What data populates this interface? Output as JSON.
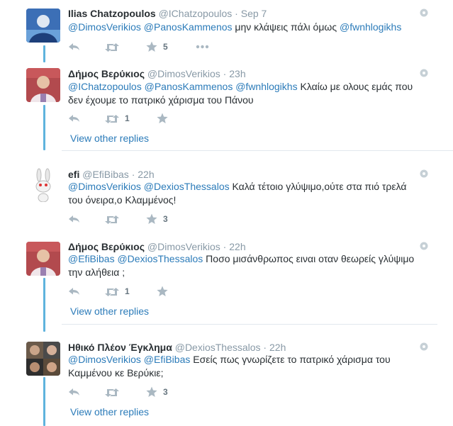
{
  "tweets": [
    {
      "fullname": "Ilias Chatzopoulos",
      "username": "@IChatzopoulos",
      "time": "Sep 7",
      "mentions": [
        "@DimosVerikios",
        "@PanosKammenos"
      ],
      "text_line1_mid": "μην κλάψεις πάλι όμως",
      "mention_end": "@fwnhlogikhs",
      "favorites": "5"
    },
    {
      "fullname": "Δήμος Βερύκιος",
      "username": "@DimosVerikios",
      "time": "23h",
      "mentions": [
        "@IChatzopoulos",
        "@PanosKammenos",
        "@fwnhlogikhs"
      ],
      "text_line1_end": "Κλαίω με ολους εμάς που",
      "text_line2": "δεν έχουμε το πατρικό χάρισμα του Πάνου",
      "retweets": "1",
      "view_other_replies": "View other replies"
    },
    {
      "fullname": "efi",
      "username": "@EfiBibas",
      "time": "22h",
      "mentions": [
        "@DimosVerikios",
        "@DexiosThessalos"
      ],
      "text_line1_end": "Καλά τέτοιο γλύψιμο,ούτε στα πιό τρελά",
      "text_line2": "του όνειρα,ο Κλαμμένος!",
      "favorites": "3"
    },
    {
      "fullname": "Δήμος Βερύκιος",
      "username": "@DimosVerikios",
      "time": "22h",
      "mentions": [
        "@EfiBibas",
        "@DexiosThessalos"
      ],
      "text_line1_end": "Ποσο μισάνθρωπος ειναι οταν θεωρείς γλύψιμο",
      "text_line2": "την αλήθεια ;",
      "retweets": "1",
      "view_other_replies": "View other replies"
    },
    {
      "fullname": "Ηθικό Πλέον Έγκλημα",
      "username": "@DexiosThessalos",
      "time": "22h",
      "mentions": [
        "@DimosVerikios",
        "@EfiBibas"
      ],
      "text_line1_end": "Εσείς πως γνωρίζετε το πατρικό χάρισμα του",
      "text_line2": "Καμμένου κε Βερύκιε;",
      "favorites": "3",
      "view_other_replies": "View other replies"
    }
  ],
  "separator": " · ",
  "icons": [
    "reply-icon",
    "retweet-icon",
    "favorite-star-icon",
    "more-dots-icon",
    "settings-gear-icon"
  ],
  "colors": {
    "thread_line": "#5fb3dd",
    "link": "#2b7bb9",
    "muted": "#8899a6",
    "icon": "#aab8c2"
  }
}
